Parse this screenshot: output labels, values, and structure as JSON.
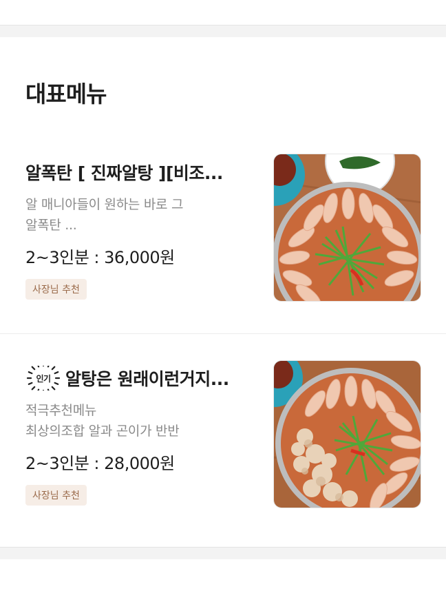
{
  "section": {
    "title": "대표메뉴"
  },
  "menu_items": [
    {
      "name": "알폭탄 [ 진짜알탕 ][비조...",
      "description_line1": "알 매니아들이 원하는 바로 그",
      "description_line2": "알폭탄 ...",
      "price": "2~3인분 : 36,000원",
      "badge": "사장님 추천",
      "photo_icon": "seafood-hotpot-photo"
    },
    {
      "popular_label": "인기",
      "name": "알탕은 원래이런거지...",
      "description_line1": "적극추천메뉴",
      "description_line2": "최상의조합 알과 곤이가 반반",
      "price": "2~3인분 : 28,000원",
      "badge": "사장님 추천",
      "photo_icon": "seafood-hotpot-photo"
    }
  ],
  "colors": {
    "badge_bg": "#f6ede6",
    "badge_text": "#9a6a4a",
    "divider": "#f3f3f3"
  }
}
